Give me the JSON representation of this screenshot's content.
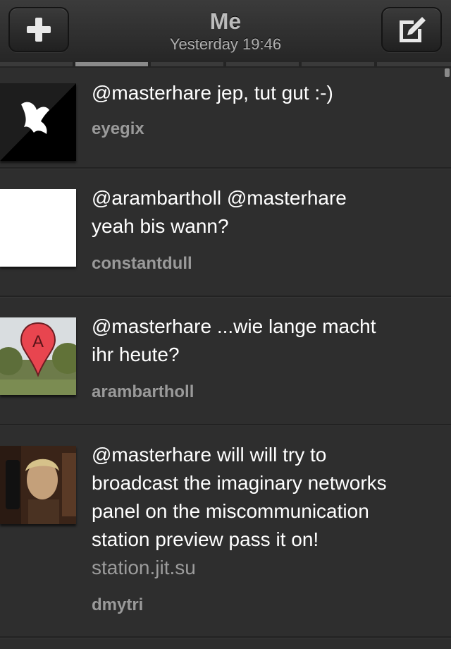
{
  "header": {
    "title": "Me",
    "subtitle": "Yesterday 19:46",
    "add_icon": "plus-icon",
    "compose_icon": "compose-icon"
  },
  "tweets": [
    {
      "text": "@masterhare jep, tut gut :-)",
      "author": "eyegix",
      "avatar": "bat-avatar"
    },
    {
      "text": "@arambartholl @masterhare\nyeah bis wann?",
      "author": "constantdull",
      "avatar": "blank-avatar"
    },
    {
      "text": "@masterhare ...wie lange macht\nihr heute?",
      "author": "arambartholl",
      "avatar": "map-pin-balloon-avatar"
    },
    {
      "text": "@masterhare will will try to\nbroadcast the imaginary networks\npanel on the miscommunication\nstation preview pass it on!",
      "link": "station.jit.su",
      "author": "dmytri",
      "avatar": "portrait-avatar"
    }
  ],
  "colors": {
    "background": "#2e2e2e",
    "text": "#ffffff",
    "author": "#9a9a9a"
  }
}
